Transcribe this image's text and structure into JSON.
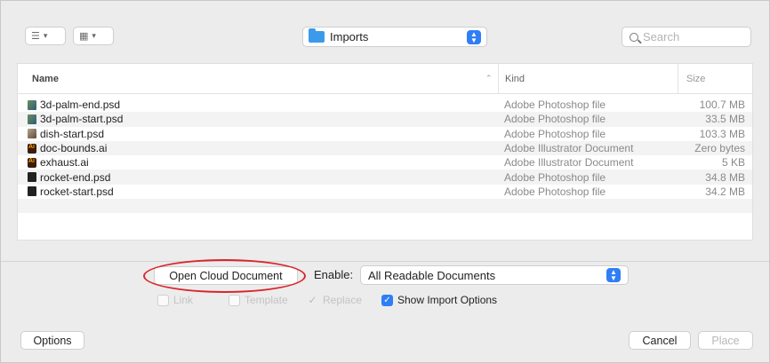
{
  "toolbar": {
    "view_list_icon": "list-icon",
    "view_grid_icon": "grid-icon",
    "location": "Imports",
    "search_placeholder": "Search"
  },
  "columns": {
    "name": "Name",
    "kind": "Kind",
    "size": "Size"
  },
  "files": [
    {
      "name": "3d-palm-end.psd",
      "kind": "Adobe Photoshop file",
      "size": "100.7 MB",
      "icon": "psd-thumbnail-icon"
    },
    {
      "name": "3d-palm-start.psd",
      "kind": "Adobe Photoshop file",
      "size": "33.5 MB",
      "icon": "psd-thumbnail-icon"
    },
    {
      "name": "dish-start.psd",
      "kind": "Adobe Photoshop file",
      "size": "103.3 MB",
      "icon": "psd-thumbnail-icon"
    },
    {
      "name": "doc-bounds.ai",
      "kind": "Adobe Illustrator Document",
      "size": "Zero bytes",
      "icon": "ai-file-icon"
    },
    {
      "name": "exhaust.ai",
      "kind": "Adobe Illustrator Document",
      "size": "5 KB",
      "icon": "ai-file-icon"
    },
    {
      "name": "rocket-end.psd",
      "kind": "Adobe Photoshop file",
      "size": "34.8 MB",
      "icon": "psd-thumbnail-icon"
    },
    {
      "name": "rocket-start.psd",
      "kind": "Adobe Photoshop file",
      "size": "34.2 MB",
      "icon": "psd-thumbnail-icon"
    }
  ],
  "bottom": {
    "open_cloud": "Open Cloud Document",
    "enable_label": "Enable:",
    "enable_value": "All Readable Documents",
    "link": "Link",
    "template": "Template",
    "replace": "Replace",
    "show_import": "Show Import Options",
    "options": "Options",
    "cancel": "Cancel",
    "place": "Place"
  },
  "colors": {
    "accent": "#2f7ef6",
    "highlight_ring": "#d9252c"
  }
}
